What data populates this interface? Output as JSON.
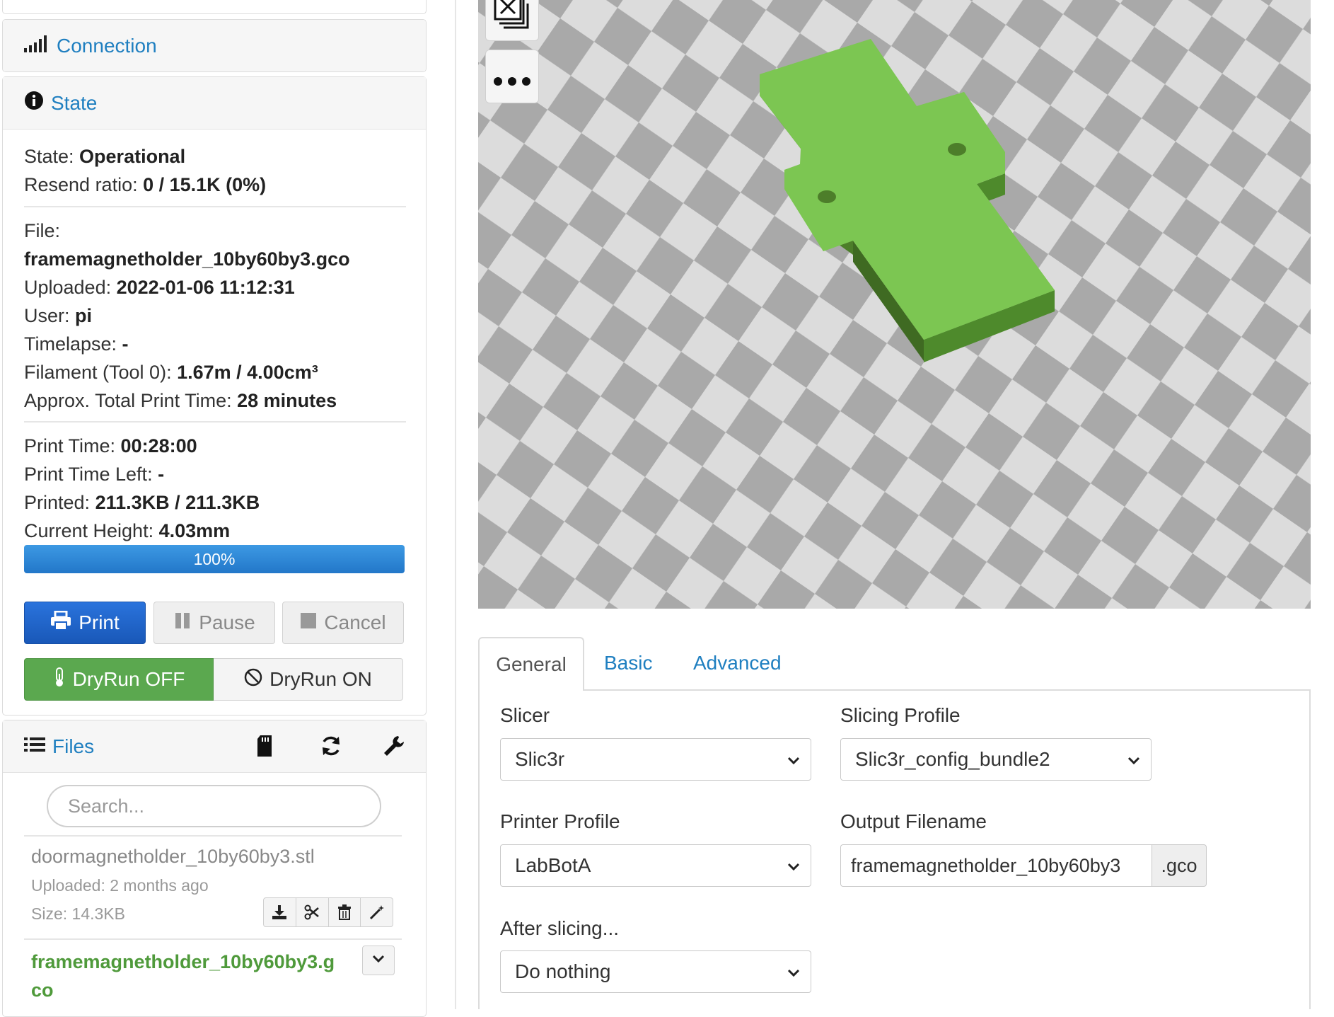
{
  "sidebar": {
    "connection": {
      "title": "Connection"
    },
    "state": {
      "title": "State",
      "state_label": "State: ",
      "state_value": "Operational",
      "resend_label": "Resend ratio: ",
      "resend_value": "0 / 15.1K (0%)",
      "file_label": "File:",
      "file_value": "framemagnetholder_10by60by3.gco",
      "uploaded_label": "Uploaded: ",
      "uploaded_value": "2022-01-06 11:12:31",
      "user_label": "User: ",
      "user_value": "pi",
      "timelapse_label": "Timelapse: ",
      "timelapse_value": "-",
      "filament_label": "Filament (Tool 0): ",
      "filament_value": "1.67m / 4.00cm³",
      "approx_label": "Approx. Total Print Time: ",
      "approx_value": "28 minutes",
      "print_time_label": "Print Time: ",
      "print_time_value": "00:28:00",
      "time_left_label": "Print Time Left: ",
      "time_left_value": "-",
      "printed_label": "Printed: ",
      "printed_value": "211.3KB / 211.3KB",
      "height_label": "Current Height: ",
      "height_value": "4.03mm",
      "progress_percent": 100,
      "progress_text": "100%",
      "print_button": "Print",
      "pause_button": "Pause",
      "cancel_button": "Cancel",
      "dryrun_off": "DryRun OFF",
      "dryrun_on": "DryRun ON"
    },
    "files": {
      "title": "Files",
      "search_placeholder": "Search...",
      "items": [
        {
          "name": "doormagnetholder_10by60by3.stl",
          "uploaded": "Uploaded: 2 months ago",
          "size": "Size: 14.3KB"
        },
        {
          "name_line1": "framemagnetholder_10by60by3.g",
          "name_line2": "co"
        }
      ]
    }
  },
  "slicer": {
    "tabs": [
      "General",
      "Basic",
      "Advanced"
    ],
    "active_tab": "General",
    "slicer_label": "Slicer",
    "slicer_value": "Slic3r",
    "profile_label": "Slicing Profile",
    "profile_value": "Slic3r_config_bundle2",
    "printer_label": "Printer Profile",
    "printer_value": "LabBotA",
    "output_label": "Output Filename",
    "output_value": "framemagnetholder_10by60by3",
    "output_suffix": ".gco",
    "after_label": "After slicing...",
    "after_value": "Do nothing"
  },
  "colors": {
    "link": "#1f7fc0",
    "primary": "#1d62c9",
    "success": "#5ba84f",
    "model": "#7cc652",
    "progress": "#2f8ad6"
  }
}
